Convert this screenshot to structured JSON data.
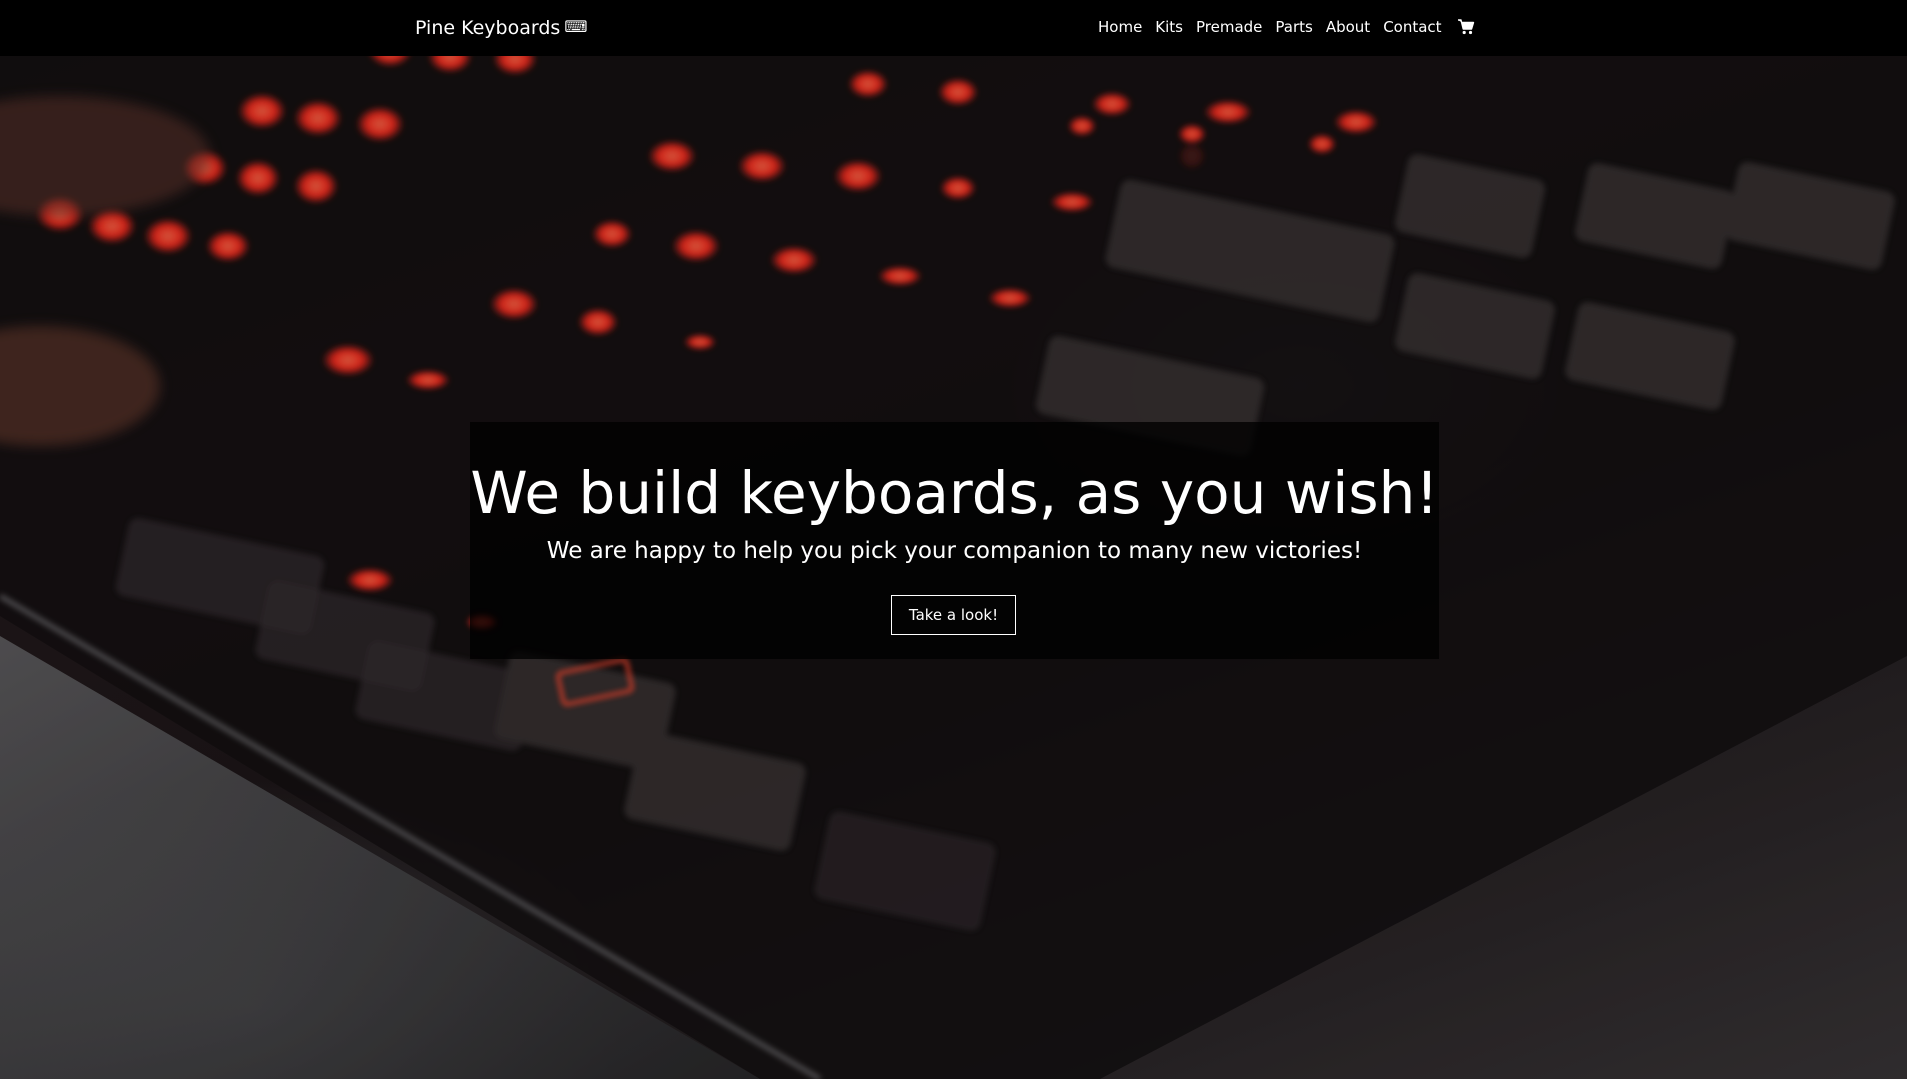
{
  "navbar": {
    "brand": "Pine Keyboards",
    "brand_icon": "keyboard-icon",
    "links": [
      {
        "label": "Home"
      },
      {
        "label": "Kits"
      },
      {
        "label": "Premade"
      },
      {
        "label": "Parts"
      },
      {
        "label": "About"
      },
      {
        "label": "Contact"
      }
    ],
    "cart_icon": "shopping-cart-icon"
  },
  "hero": {
    "background": "photo of backlit mechanical keyboard",
    "title": "We build keyboards, as you wish!",
    "subtitle": "We are happy to help you pick your companion to many new victories!",
    "button_label": "Take a look!"
  },
  "colors": {
    "navbar_bg": "#000000",
    "text": "#ffffff",
    "key_glow": "#ff3b2f",
    "overlay": "rgba(0,0,0,0.78)"
  }
}
